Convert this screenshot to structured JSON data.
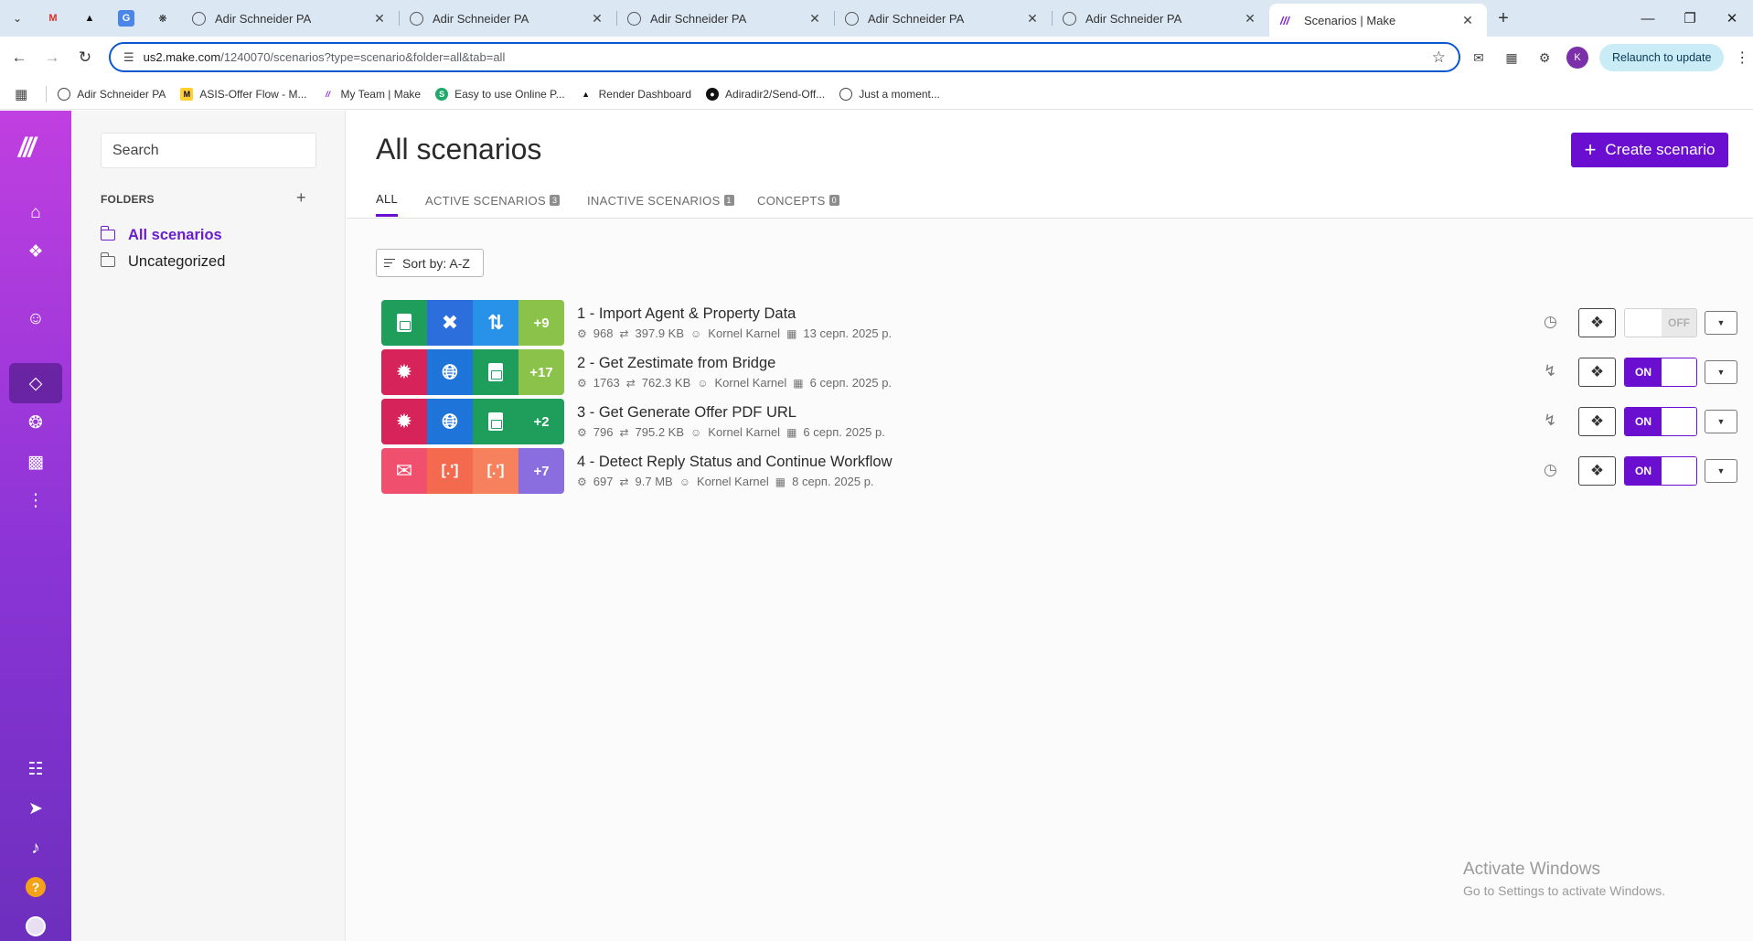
{
  "browser": {
    "tabs": [
      {
        "title": "Adir Schneider PA",
        "active": false
      },
      {
        "title": "Adir Schneider PA",
        "active": false
      },
      {
        "title": "Adir Schneider PA",
        "active": false
      },
      {
        "title": "Adir Schneider PA",
        "active": false
      },
      {
        "title": "Adir Schneider PA",
        "active": false
      },
      {
        "title": "Scenarios | Make",
        "active": true
      }
    ],
    "url_host": "us2.make.com",
    "url_path": "/1240070/scenarios?type=scenario&folder=all&tab=all",
    "profile_initial": "K",
    "relaunch_label": "Relaunch to update",
    "bookmarks": [
      {
        "label": "Adir Schneider PA",
        "icon": "globe-icon"
      },
      {
        "label": "ASIS-Offer Flow - M...",
        "icon": "miro-icon"
      },
      {
        "label": "My Team | Make",
        "icon": "make-icon"
      },
      {
        "label": "Easy to use Online P...",
        "icon": "s-icon"
      },
      {
        "label": "Render Dashboard",
        "icon": "render-icon"
      },
      {
        "label": "Adiradir2/Send-Off...",
        "icon": "github-icon"
      },
      {
        "label": "Just a moment...",
        "icon": "globe-icon"
      }
    ]
  },
  "sidebar": {
    "search_placeholder": "Search",
    "folders_heading": "FOLDERS",
    "folders": [
      {
        "label": "All scenarios",
        "active": true
      },
      {
        "label": "Uncategorized",
        "active": false
      }
    ]
  },
  "main": {
    "title": "All scenarios",
    "create_label": "Create scenario",
    "tabs": [
      {
        "label": "ALL",
        "count": null,
        "active": true
      },
      {
        "label": "ACTIVE SCENARIOS",
        "count": "3",
        "active": false
      },
      {
        "label": "INACTIVE SCENARIOS",
        "count": "1",
        "active": false
      },
      {
        "label": "CONCEPTS",
        "count": "0",
        "active": false
      }
    ],
    "sort_label": "Sort by: A-Z",
    "scenarios": [
      {
        "name": "1 - Import Agent & Property Data",
        "ops": "968",
        "data": "397.9 KB",
        "owner": "Kornel Karnel",
        "date": "13 серп. 2025 р.",
        "more": "+9",
        "trigger": "clock-icon",
        "status": "OFF",
        "apps": [
          {
            "icon": "google-sheets-icon",
            "color": "#1e9e5a"
          },
          {
            "icon": "tools-icon",
            "color": "#2c6fdc"
          },
          {
            "icon": "transfer-icon",
            "color": "#2891e8"
          }
        ],
        "more_color": "#8bc34a"
      },
      {
        "name": "2 - Get Zestimate from Bridge",
        "ops": "1763",
        "data": "762.3 KB",
        "owner": "Kornel Karnel",
        "date": "6 серп. 2025 р.",
        "more": "+17",
        "trigger": "lightning-icon",
        "status": "ON",
        "apps": [
          {
            "icon": "webhooks-icon",
            "color": "#d6235a"
          },
          {
            "icon": "http-globe-icon",
            "color": "#1e74d9"
          },
          {
            "icon": "google-sheets-icon",
            "color": "#1e9e5a"
          }
        ],
        "more_color": "#8bc34a"
      },
      {
        "name": "3 - Get Generate Offer PDF URL",
        "ops": "796",
        "data": "795.2 KB",
        "owner": "Kornel Karnel",
        "date": "6 серп. 2025 р.",
        "more": "+2",
        "trigger": "lightning-icon",
        "status": "ON",
        "apps": [
          {
            "icon": "webhooks-icon",
            "color": "#d6235a"
          },
          {
            "icon": "http-globe-icon",
            "color": "#1e74d9"
          },
          {
            "icon": "google-sheets-icon",
            "color": "#1e9e5a"
          }
        ],
        "more_color": "#1e9e5a"
      },
      {
        "name": "4 - Detect Reply Status and Continue Workflow",
        "ops": "697",
        "data": "9.7 MB",
        "owner": "Kornel Karnel",
        "date": "8 серп. 2025 р.",
        "more": "+7",
        "trigger": "clock-icon",
        "status": "ON",
        "apps": [
          {
            "icon": "email-icon",
            "color": "#f0506e"
          },
          {
            "icon": "json-icon",
            "color": "#f36a4f"
          },
          {
            "icon": "json-icon",
            "color": "#f7815c"
          }
        ],
        "more_color": "#8a6ddf"
      }
    ]
  },
  "watermark": {
    "line1": "Activate Windows",
    "line2": "Go to Settings to activate Windows."
  },
  "colors": {
    "accent": "#6a0fd0",
    "rail_top": "#c03fe0",
    "rail_bottom": "#6d2fbd"
  }
}
